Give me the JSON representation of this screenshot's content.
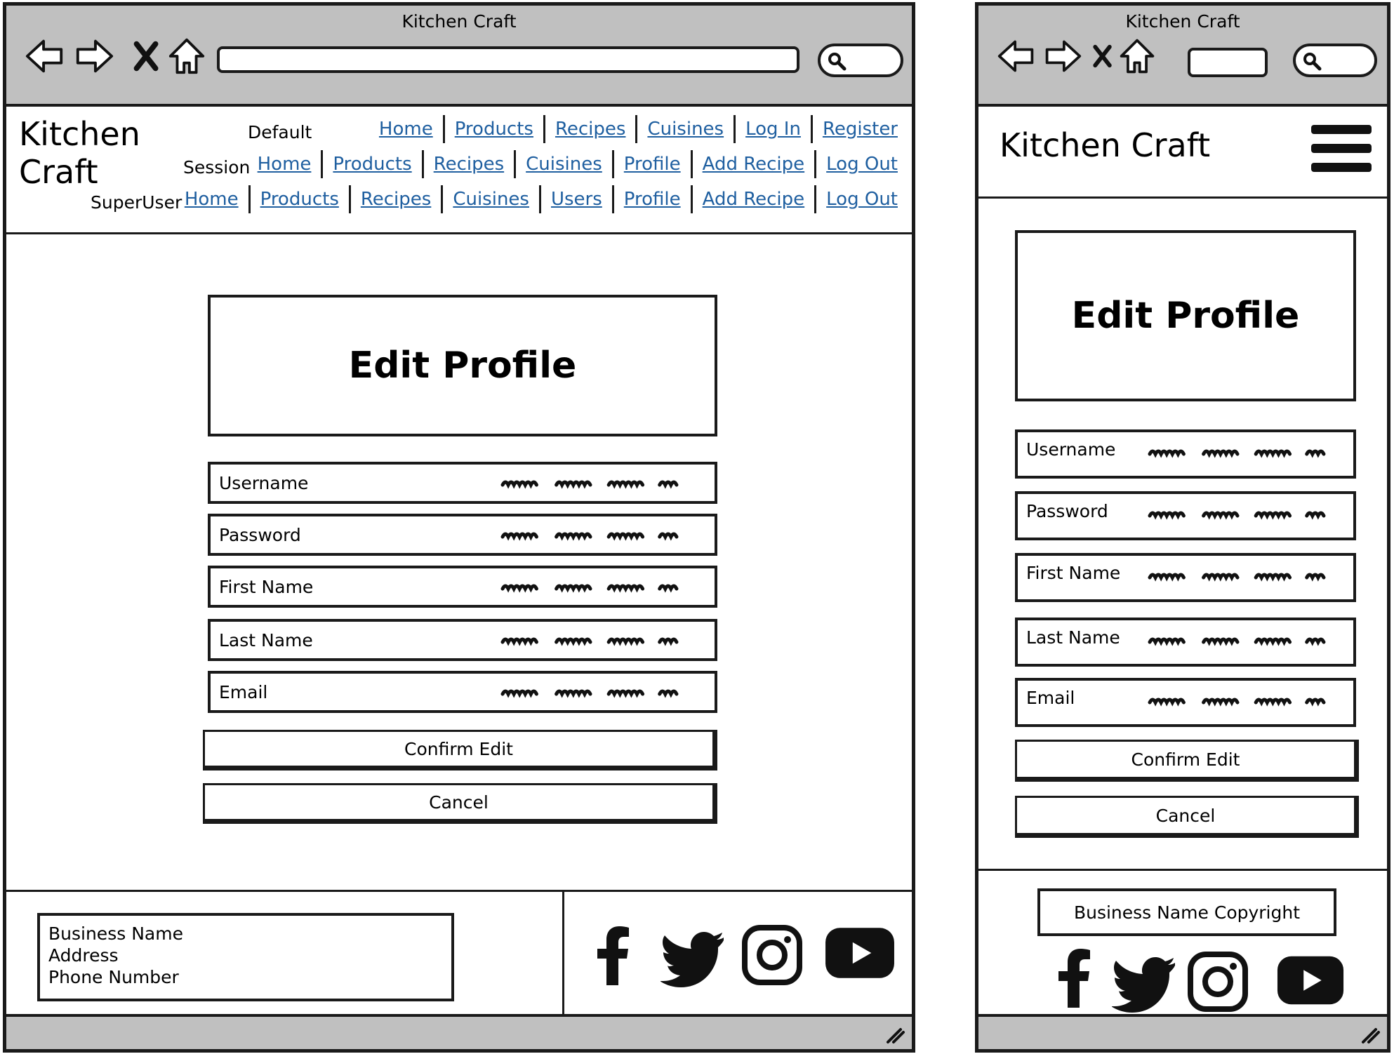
{
  "window_title": "Kitchen Craft",
  "brand": {
    "line1": "Kitchen",
    "line2": "Craft",
    "full": "Kitchen Craft"
  },
  "nav": {
    "default": {
      "label": "Default",
      "links": [
        "Home",
        "Products",
        "Recipes",
        "Cuisines",
        "Log In",
        "Register"
      ]
    },
    "session": {
      "label": "Session",
      "links": [
        "Home",
        "Products",
        "Recipes",
        "Cuisines",
        "Profile",
        "Add Recipe",
        "Log Out"
      ]
    },
    "superuser": {
      "label": "SuperUser",
      "links": [
        "Home",
        "Products",
        "Recipes",
        "Cuisines",
        "Users",
        "Profile",
        "Add Recipe",
        "Log Out"
      ]
    }
  },
  "form": {
    "title": "Edit Profile",
    "fields": [
      "Username",
      "Password",
      "First Name",
      "Last Name",
      "Email"
    ],
    "confirm_label": "Confirm Edit",
    "cancel_label": "Cancel"
  },
  "footer": {
    "business_name": "Business Name",
    "address": "Address",
    "phone": "Phone Number",
    "copyright": "Business Name Copyright"
  },
  "icons": [
    "back-icon",
    "forward-icon",
    "close-icon",
    "home-icon",
    "search-icon",
    "facebook-icon",
    "twitter-icon",
    "instagram-icon",
    "youtube-icon",
    "hamburger-menu-icon",
    "resize-grip-icon"
  ],
  "colors": {
    "chrome": "#c0c0c0",
    "link": "#1f5fa0"
  }
}
